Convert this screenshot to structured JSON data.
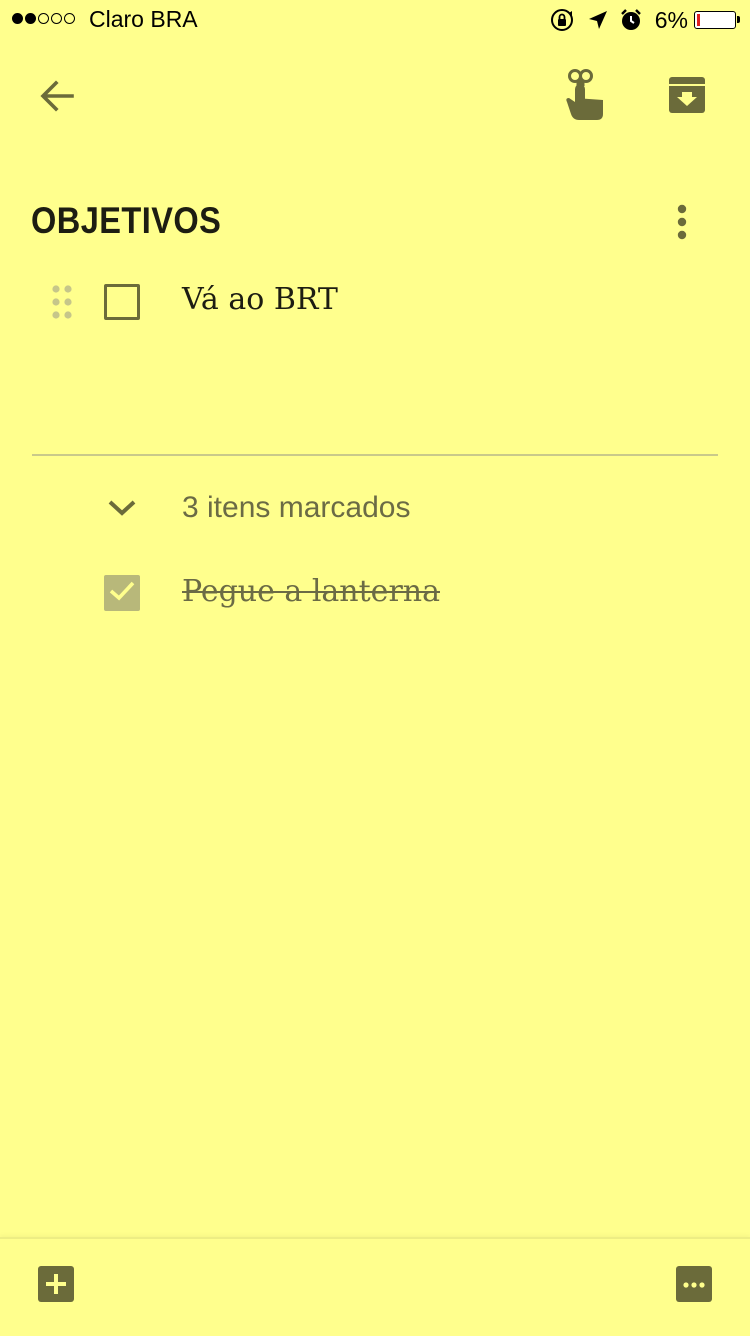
{
  "status_bar": {
    "carrier": "Claro BRA",
    "signal_bars_filled": 2,
    "signal_bars_total": 5,
    "battery_percent": "6%",
    "icons": [
      "orientation-lock-icon",
      "location-arrow-icon",
      "alarm-clock-icon",
      "battery-icon"
    ]
  },
  "toolbar": {
    "back_icon": "arrow-left-icon",
    "reminder_icon": "reminder-finger-icon",
    "archive_icon": "archive-icon"
  },
  "note": {
    "title": "OBJETIVOS",
    "menu_icon": "more-vert-icon",
    "items": [
      {
        "text": "Vá ao BRT",
        "checked": false
      }
    ],
    "checked_section": {
      "label": "3 itens marcados",
      "expanded": true
    },
    "checked_items": [
      {
        "text": "Pegue a lanterna",
        "checked": true
      }
    ]
  },
  "bottom_bar": {
    "add_icon": "add-box-icon",
    "more_icon": "more-horiz-icon"
  },
  "colors": {
    "background": "#ffff8d",
    "icon": "#6b6b3a",
    "title_text": "#1d1d12",
    "muted_text": "#6b6b45",
    "checked_box": "#b8b87a"
  }
}
